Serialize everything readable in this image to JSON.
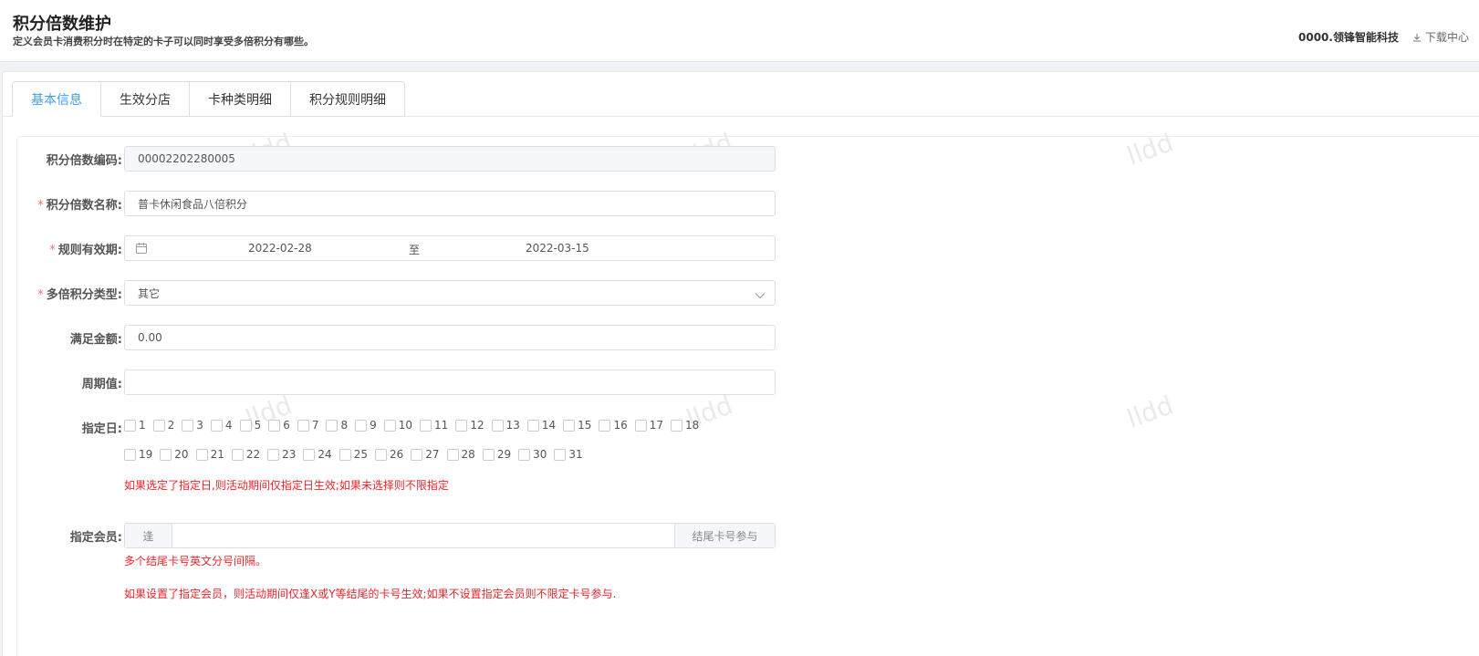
{
  "header": {
    "title": "积分倍数维护",
    "subtitle": "定义会员卡消费积分时在特定的卡子可以同时享受多倍积分有哪些。",
    "company": "0000.领锋智能科技",
    "download_label": "下载中心"
  },
  "tabs": [
    {
      "label": "基本信息",
      "active": true
    },
    {
      "label": "生效分店",
      "active": false
    },
    {
      "label": "卡种类明细",
      "active": false
    },
    {
      "label": "积分规则明细",
      "active": false
    }
  ],
  "watermark": "lldd",
  "form": {
    "code": {
      "label": "积分倍数编码:",
      "value": "00002202280005"
    },
    "name": {
      "required": "*",
      "label": "积分倍数名称:",
      "value": "普卡休闲食品八倍积分"
    },
    "validity": {
      "required": "*",
      "label": "规则有效期:",
      "start": "2022-02-28",
      "separator": "至",
      "end": "2022-03-15"
    },
    "type": {
      "required": "*",
      "label": "多倍积分类型:",
      "value": "其它"
    },
    "amount": {
      "label": "满足金额:",
      "value": "0.00"
    },
    "period": {
      "label": "周期值:",
      "value": ""
    },
    "days": {
      "label": "指定日:",
      "row1": [
        "1",
        "2",
        "3",
        "4",
        "5",
        "6",
        "7",
        "8",
        "9",
        "10",
        "11",
        "12",
        "13",
        "14",
        "15",
        "16",
        "17",
        "18"
      ],
      "row2": [
        "19",
        "20",
        "21",
        "22",
        "23",
        "24",
        "25",
        "26",
        "27",
        "28",
        "29",
        "30",
        "31"
      ],
      "hint": "如果选定了指定日,则活动期间仅指定日生效;如果未选择则不限指定"
    },
    "member": {
      "label": "指定会员:",
      "prefix": "逢",
      "value": "",
      "suffix": "结尾卡号参与",
      "hint1": "多个结尾卡号英文分号间隔。",
      "hint2": "如果设置了指定会员，则活动期间仅逢X或Y等结尾的卡号生效;如果不设置指定会员则不限定卡号参与."
    }
  }
}
